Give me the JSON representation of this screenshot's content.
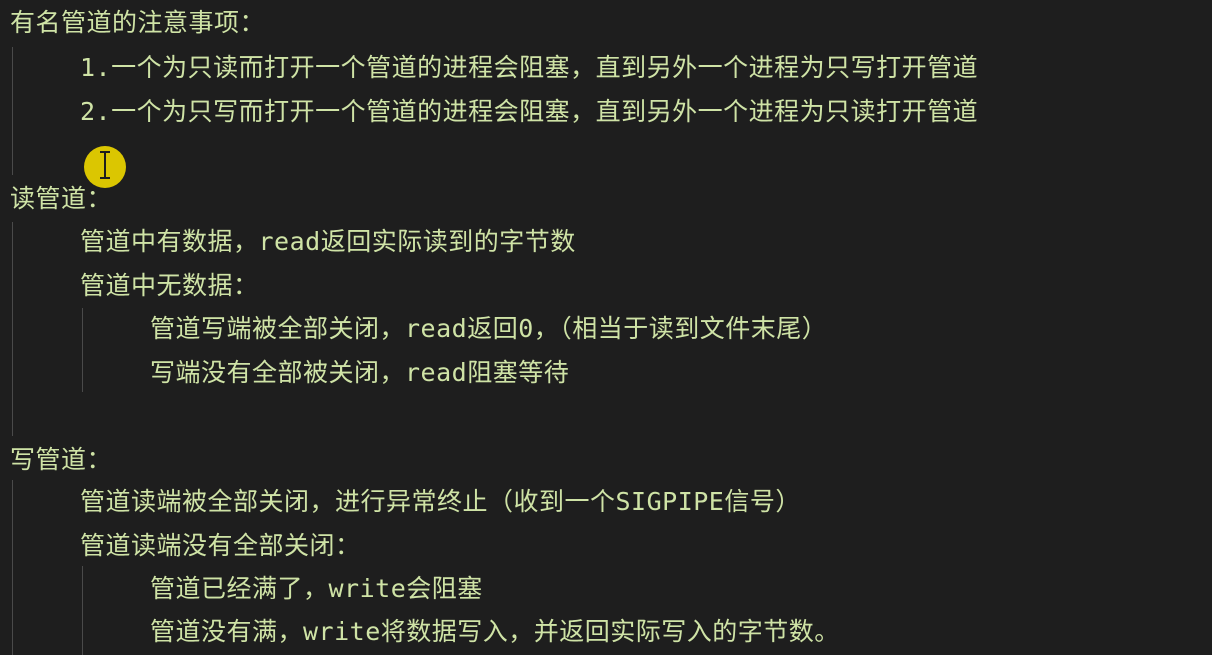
{
  "editor": {
    "lines": [
      {
        "text": "有名管道的注意事项："
      },
      {
        "text": "1.一个为只读而打开一个管道的进程会阻塞，直到另外一个进程为只写打开管道"
      },
      {
        "text": "2.一个为只写而打开一个管道的进程会阻塞，直到另外一个进程为只读打开管道"
      },
      {
        "text": ""
      },
      {
        "text": "读管道："
      },
      {
        "text": "管道中有数据，read返回实际读到的字节数"
      },
      {
        "text": "管道中无数据："
      },
      {
        "text": "管道写端被全部关闭，read返回0，（相当于读到文件末尾）"
      },
      {
        "text": "写端没有全部被关闭，read阻塞等待"
      },
      {
        "text": ""
      },
      {
        "text": "写管道："
      },
      {
        "text": "管道读端被全部关闭，进行异常终止（收到一个SIGPIPE信号）"
      },
      {
        "text": "管道读端没有全部关闭："
      },
      {
        "text": "管道已经满了，write会阻塞"
      },
      {
        "text": "管道没有满，write将数据写入，并返回实际写入的字节数。"
      }
    ],
    "colors": {
      "background": "#1e1e1e",
      "text": "#cfe3a6",
      "indent_guide": "#4a4a4a",
      "cursor_highlight": "#e6d000"
    },
    "icons": {
      "cursor": "i-beam-cursor-icon"
    }
  }
}
